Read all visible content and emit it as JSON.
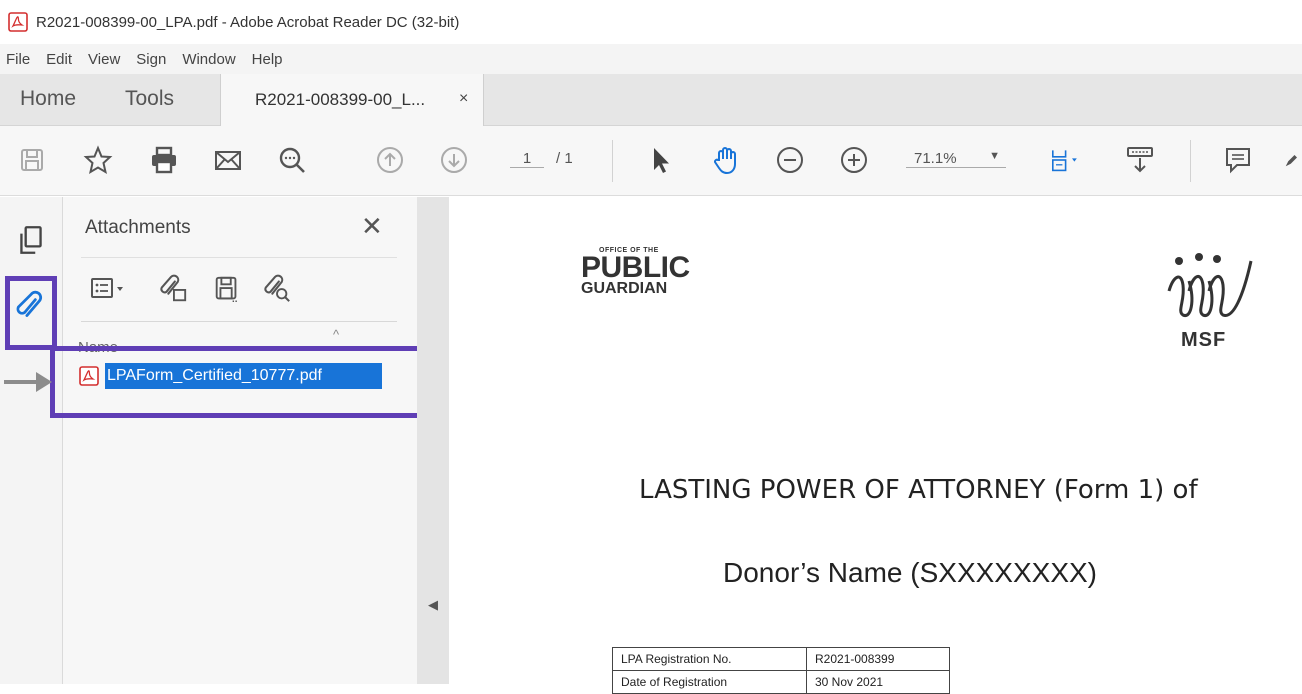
{
  "window": {
    "title": "R2021-008399-00_LPA.pdf - Adobe Acrobat Reader DC (32-bit)"
  },
  "menu": {
    "items": [
      "File",
      "Edit",
      "View",
      "Sign",
      "Window",
      "Help"
    ]
  },
  "tabs": {
    "home": "Home",
    "tools": "Tools",
    "document": "R2021-008399-00_L...",
    "close": "×"
  },
  "toolbar": {
    "page_current": "1",
    "page_total": "/ 1",
    "zoom": "71.1%",
    "icons": [
      "save-icon",
      "bookmark-star-icon",
      "print-icon",
      "email-icon",
      "search-icon",
      "page-up-icon",
      "page-down-icon",
      "select-cursor-icon",
      "hand-tool-icon",
      "zoom-out-icon",
      "zoom-in-icon",
      "fit-page-icon",
      "scroll-mode-icon",
      "comment-icon"
    ]
  },
  "attachments": {
    "title": "Attachments",
    "close": "✕",
    "column_name": "Name",
    "files": [
      "LPAForm_Certified_10777.pdf"
    ]
  },
  "document": {
    "logo_small": "OFFICE OF THE",
    "logo_public": "PUBLIC",
    "logo_guardian": "GUARDIAN",
    "msf_label": "MSF",
    "heading": "LASTING POWER OF ATTORNEY (Form 1) of",
    "donor": "Donor’s Name (SXXXXXXXX)",
    "table": [
      {
        "key": "LPA Registration No.",
        "value": "R2021-008399"
      },
      {
        "key": "Date of Registration",
        "value": "30 Nov 2021"
      }
    ]
  },
  "colors": {
    "highlight": "#5f3eb5",
    "selection": "#1874d8",
    "acrobat_red": "#d32f2f"
  }
}
